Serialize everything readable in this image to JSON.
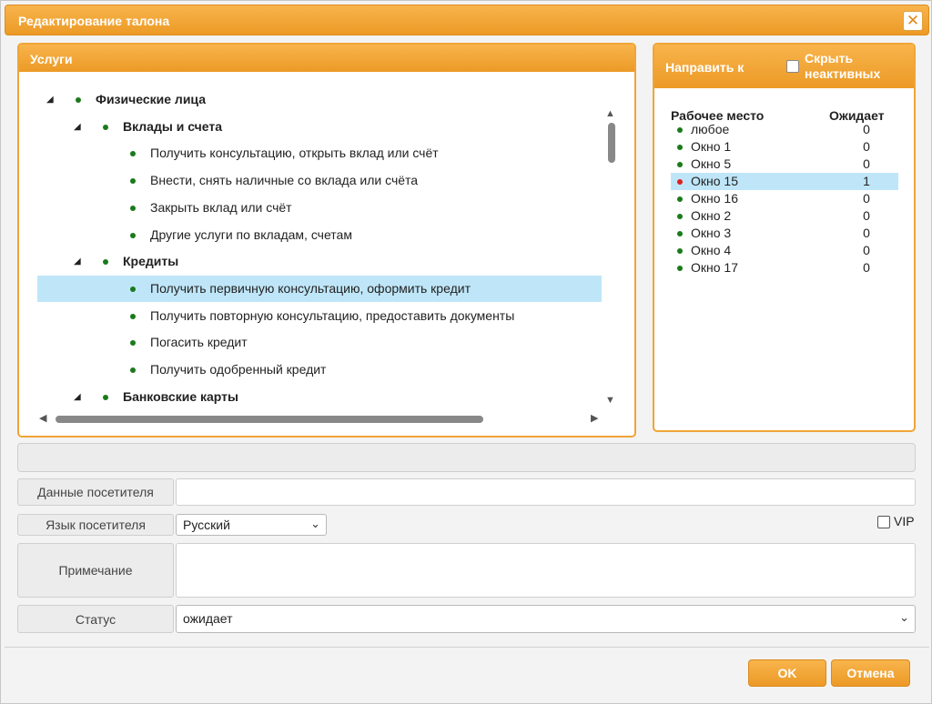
{
  "window": {
    "title": "Редактирование талона",
    "close_label": "✕"
  },
  "services": {
    "title": "Услуги",
    "tree": [
      {
        "label": "Физические лица",
        "level": 0,
        "bold": true
      },
      {
        "label": "Вклады и счета",
        "level": 1,
        "bold": true
      },
      {
        "label": "Получить консультацию, открыть вклад или счёт",
        "level": 2
      },
      {
        "label": "Внести, снять наличные со вклада или счёта",
        "level": 2
      },
      {
        "label": "Закрыть вклад или счёт",
        "level": 2
      },
      {
        "label": "Другие услуги по вкладам, счетам",
        "level": 2
      },
      {
        "label": "Кредиты",
        "level": 1,
        "bold": true
      },
      {
        "label": "Получить первичную консультацию, оформить кредит",
        "level": 2,
        "selected": true
      },
      {
        "label": "Получить повторную консультацию, предоставить документы",
        "level": 2
      },
      {
        "label": "Погасить кредит",
        "level": 2
      },
      {
        "label": "Получить одобренный кредит",
        "level": 2
      },
      {
        "label": "Банковские карты",
        "level": 1,
        "bold": true
      }
    ]
  },
  "direct": {
    "title": "Направить к",
    "hide_label": "Скрыть неактивных",
    "col_workplace": "Рабочее место",
    "col_waiting": "Ожидает",
    "rows": [
      {
        "name": "любое",
        "count": "0",
        "status": "green"
      },
      {
        "name": "Окно 1",
        "count": "0",
        "status": "green"
      },
      {
        "name": "Окно 5",
        "count": "0",
        "status": "green"
      },
      {
        "name": "Окно 15",
        "count": "1",
        "status": "red",
        "selected": true
      },
      {
        "name": "Окно 16",
        "count": "0",
        "status": "green"
      },
      {
        "name": "Окно 2",
        "count": "0",
        "status": "green"
      },
      {
        "name": "Окно 3",
        "count": "0",
        "status": "green"
      },
      {
        "name": "Окно 4",
        "count": "0",
        "status": "green"
      },
      {
        "name": "Окно 17",
        "count": "0",
        "status": "green"
      }
    ]
  },
  "form": {
    "visitor_label": "Данные посетителя",
    "language_label": "Язык посетителя",
    "language_value": "Русский",
    "vip_label": "VIP",
    "note_label": "Примечание",
    "status_label": "Статус",
    "status_value": "ожидает"
  },
  "buttons": {
    "ok": "OK",
    "cancel": "Отмена"
  },
  "colors": {
    "accent": "#f0a536",
    "selection": "#bfe6f8",
    "dot_green": "#1a7a1a",
    "dot_red": "#e02020"
  }
}
